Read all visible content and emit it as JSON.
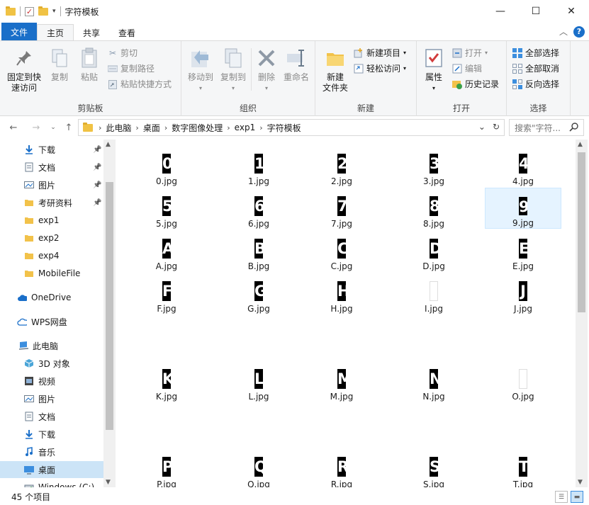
{
  "window": {
    "title": "字符模板",
    "controls": {
      "minimize": "—",
      "maximize": "☐",
      "close": "✕"
    }
  },
  "tabs": {
    "file": "文件",
    "home": "主页",
    "share": "共享",
    "view": "查看"
  },
  "ribbon": {
    "clipboard": {
      "label": "剪贴板",
      "pin_quick": "固定到快\n速访问",
      "copy": "复制",
      "paste": "粘贴",
      "cut": "剪切",
      "copy_path": "复制路径",
      "paste_shortcut": "粘贴快捷方式"
    },
    "organize": {
      "label": "组织",
      "move_to": "移动到",
      "copy_to": "复制到",
      "delete": "删除",
      "rename": "重命名"
    },
    "new": {
      "label": "新建",
      "new_folder": "新建\n文件夹",
      "new_item": "新建项目",
      "easy_access": "轻松访问"
    },
    "open": {
      "label": "打开",
      "properties": "属性",
      "open": "打开",
      "edit": "编辑",
      "history": "历史记录"
    },
    "select": {
      "label": "选择",
      "select_all": "全部选择",
      "select_none": "全部取消",
      "invert": "反向选择"
    }
  },
  "address": {
    "crumbs": [
      "此电脑",
      "桌面",
      "数字图像处理",
      "exp1",
      "字符模板"
    ],
    "search_placeholder": "搜索\"字符..."
  },
  "nav": {
    "items": [
      {
        "label": "下载",
        "icon": "download-icon",
        "pinned": true
      },
      {
        "label": "文档",
        "icon": "document-icon",
        "pinned": true
      },
      {
        "label": "图片",
        "icon": "picture-icon",
        "pinned": true
      },
      {
        "label": "考研资料",
        "icon": "folder-icon",
        "pinned": true
      },
      {
        "label": "exp1",
        "icon": "folder-icon"
      },
      {
        "label": "exp2",
        "icon": "folder-icon"
      },
      {
        "label": "exp4",
        "icon": "folder-icon"
      },
      {
        "label": "MobileFile",
        "icon": "folder-icon"
      },
      {
        "label": "OneDrive",
        "icon": "cloud-icon"
      },
      {
        "label": "WPS网盘",
        "icon": "cloud-outline-icon"
      },
      {
        "label": "此电脑",
        "icon": "computer-icon"
      },
      {
        "label": "3D 对象",
        "icon": "cube-icon"
      },
      {
        "label": "视频",
        "icon": "video-icon"
      },
      {
        "label": "图片",
        "icon": "picture-icon"
      },
      {
        "label": "文档",
        "icon": "document-icon"
      },
      {
        "label": "下载",
        "icon": "download-icon"
      },
      {
        "label": "音乐",
        "icon": "music-icon"
      },
      {
        "label": "桌面",
        "icon": "desktop-icon",
        "selected": true
      },
      {
        "label": "Windows (C:)",
        "icon": "drive-icon"
      }
    ]
  },
  "files": [
    {
      "name": "0.jpg",
      "glyph": "0"
    },
    {
      "name": "1.jpg",
      "glyph": "1"
    },
    {
      "name": "2.jpg",
      "glyph": "2"
    },
    {
      "name": "3.jpg",
      "glyph": "3"
    },
    {
      "name": "4.jpg",
      "glyph": "4"
    },
    {
      "name": "5.jpg",
      "glyph": "5"
    },
    {
      "name": "6.jpg",
      "glyph": "6"
    },
    {
      "name": "7.jpg",
      "glyph": "7"
    },
    {
      "name": "8.jpg",
      "glyph": "8"
    },
    {
      "name": "9.jpg",
      "glyph": "9",
      "selected": true
    },
    {
      "name": "A.jpg",
      "glyph": "A"
    },
    {
      "name": "B.jpg",
      "glyph": "B"
    },
    {
      "name": "C.jpg",
      "glyph": "C"
    },
    {
      "name": "D.jpg",
      "glyph": "D"
    },
    {
      "name": "E.jpg",
      "glyph": "E"
    },
    {
      "name": "F.jpg",
      "glyph": "F"
    },
    {
      "name": "G.jpg",
      "glyph": "G"
    },
    {
      "name": "H.jpg",
      "glyph": "H"
    },
    {
      "name": "I.jpg",
      "glyph": "",
      "blank": true
    },
    {
      "name": "J.jpg",
      "glyph": "J"
    },
    {
      "name": "K.jpg",
      "glyph": "K"
    },
    {
      "name": "L.jpg",
      "glyph": "L"
    },
    {
      "name": "M.jpg",
      "glyph": "M"
    },
    {
      "name": "N.jpg",
      "glyph": "N"
    },
    {
      "name": "O.jpg",
      "glyph": "",
      "blank": true
    },
    {
      "name": "P.jpg",
      "glyph": "P"
    },
    {
      "name": "Q.jpg",
      "glyph": "Q"
    },
    {
      "name": "R.jpg",
      "glyph": "R"
    },
    {
      "name": "S.jpg",
      "glyph": "S"
    },
    {
      "name": "T.jpg",
      "glyph": "T"
    }
  ],
  "status": {
    "count": "45 个项目"
  },
  "colors": {
    "accent": "#1a6fc9",
    "selection": "#cce4f7"
  }
}
